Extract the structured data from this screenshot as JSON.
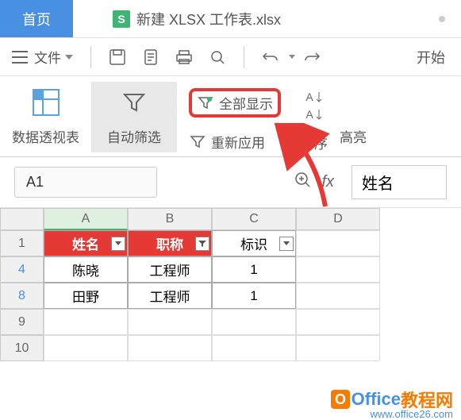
{
  "tabs": {
    "home": "首页",
    "file_tab": "新建 XLSX 工作表.xlsx",
    "file_icon": "S"
  },
  "menu": {
    "file": "文件",
    "start": "开始"
  },
  "ribbon": {
    "pivot": "数据透视表",
    "auto_filter": "自动筛选",
    "show_all": "全部显示",
    "reapply": "重新应用",
    "sort": "排序",
    "highlight": "高亮"
  },
  "namebox": "A1",
  "formula": "姓名",
  "columns": [
    "A",
    "B",
    "C",
    "D"
  ],
  "header_row": {
    "num": "1",
    "cells": [
      "姓名",
      "职称",
      "标识"
    ]
  },
  "data_rows": [
    {
      "num": "4",
      "cells": [
        "陈晓",
        "工程师",
        "1"
      ]
    },
    {
      "num": "8",
      "cells": [
        "田野",
        "工程师",
        "1"
      ]
    }
  ],
  "empty_rows": [
    "9",
    "10"
  ],
  "watermark": {
    "brand1": "Office",
    "brand2": "教程网",
    "url": "www.office26.com"
  }
}
